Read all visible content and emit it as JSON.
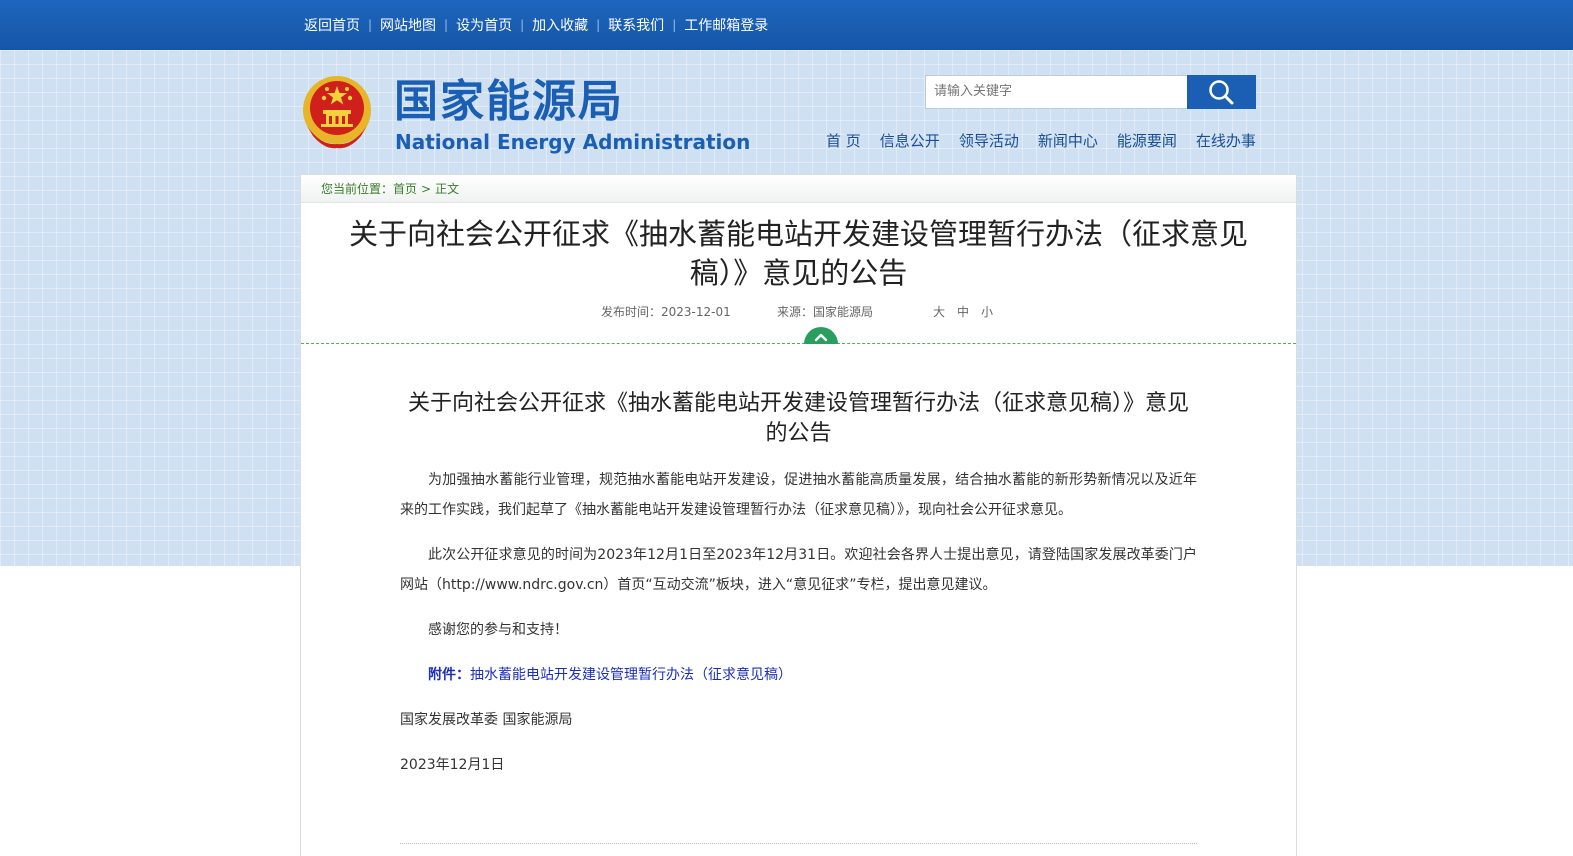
{
  "top_links": [
    "返回首页",
    "网站地图",
    "设为首页",
    "加入收藏",
    "联系我们",
    "工作邮箱登录"
  ],
  "logo": {
    "cn": "国家能源局",
    "en": "National Energy Administration"
  },
  "search": {
    "placeholder": "请输入关键字"
  },
  "main_nav": [
    "首 页",
    "信息公开",
    "领导活动",
    "新闻中心",
    "能源要闻",
    "在线办事"
  ],
  "breadcrumb": {
    "prefix": "您当前位置：",
    "home": "首页",
    "arrow": ">",
    "current": "正文"
  },
  "article": {
    "title": "关于向社会公开征求《抽水蓄能电站开发建设管理暂行办法（征求意见稿）》意见的公告",
    "date_label": "发布时间：2023-12-01",
    "source_label": "来源：国家能源局",
    "font_sizes": [
      "大",
      "中",
      "小"
    ],
    "inner_title": "关于向社会公开征求《抽水蓄能电站开发建设管理暂行办法（征求意见稿）》意见的公告",
    "para1": "为加强抽水蓄能行业管理，规范抽水蓄能电站开发建设，促进抽水蓄能高质量发展，结合抽水蓄能的新形势新情况以及近年来的工作实践，我们起草了《抽水蓄能电站开发建设管理暂行办法（征求意见稿）》，现向社会公开征求意见。",
    "para2": "此次公开征求意见的时间为2023年12月1日至2023年12月31日。欢迎社会各界人士提出意见，请登陆国家发展改革委门户网站（http://www.ndrc.gov.cn）首页“互动交流”板块，进入“意见征求”专栏，提出意见建议。",
    "para3": "感谢您的参与和支持！",
    "attach_label": "附件：",
    "attach_link": "抽水蓄能电站开发建设管理暂行办法（征求意见稿）",
    "signature": "国家发展改革委  国家能源局",
    "sign_date": "2023年12月1日"
  },
  "colors": {
    "topbar": "#1a5fb4",
    "brand_blue": "#1a5fb4",
    "breadcrumb_green": "#3a7d2a",
    "collapse_green": "#2a9e5c",
    "attach_blue": "#1c2fb8"
  },
  "icons": {
    "search": "search-icon",
    "emblem": "national-emblem-icon",
    "collapse": "chevron-up-icon"
  }
}
